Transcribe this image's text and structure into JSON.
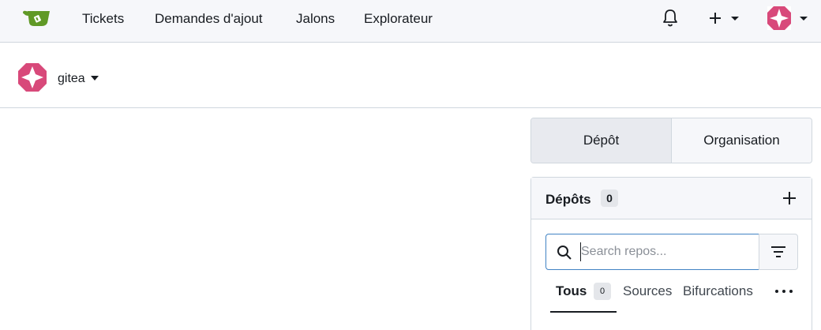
{
  "navbar": {
    "links": [
      "Tickets",
      "Demandes d'ajout",
      "Jalons",
      "Explorateur"
    ],
    "logo_icon": "gitea-teacup-logo-icon",
    "bell_icon": "bell-icon",
    "plus_icon": "plus-icon",
    "avatar_icon": "identicon-avatar"
  },
  "context": {
    "org_name": "gitea",
    "avatar_icon": "identicon-avatar"
  },
  "segment": {
    "active": "Dépôt",
    "inactive": "Organisation"
  },
  "repos": {
    "title": "Dépôts",
    "count": "0",
    "search_placeholder": "Search repos...",
    "tabs": [
      {
        "label": "Tous",
        "count": "0"
      },
      {
        "label": "Sources"
      },
      {
        "label": "Bifurcations"
      }
    ]
  },
  "colors": {
    "logo_green": "#609926",
    "avatar_pink": "#d8497a",
    "focus_blue": "#4183c4"
  }
}
